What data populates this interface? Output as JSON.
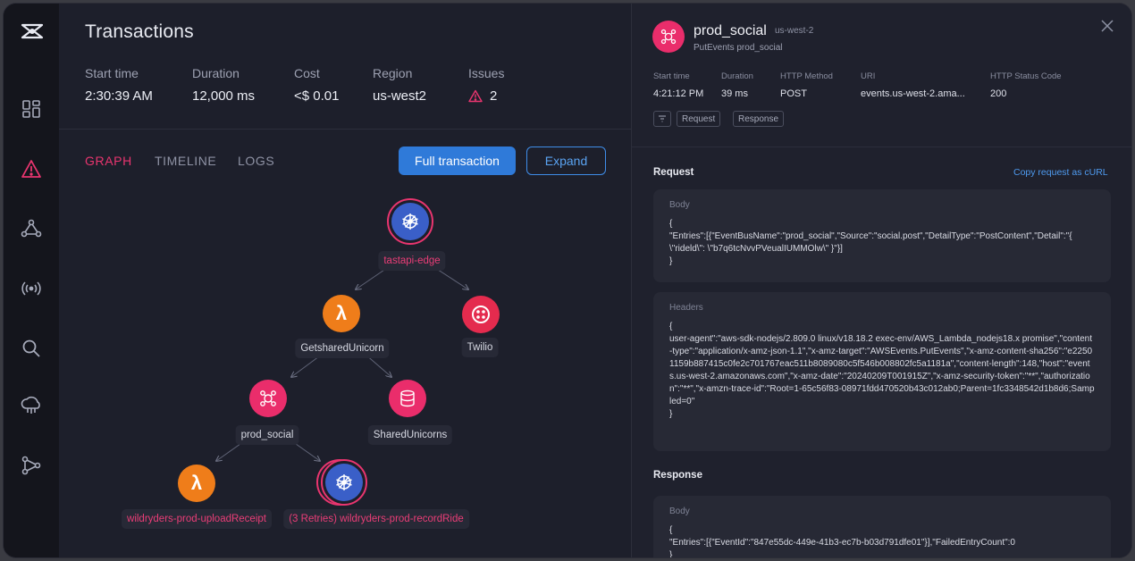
{
  "sidebar": {
    "items": [
      {
        "icon": "logo-icon"
      },
      {
        "icon": "dashboard-icon"
      },
      {
        "icon": "alert-icon",
        "active": true
      },
      {
        "icon": "graph-nodes-icon"
      },
      {
        "icon": "broadcast-icon"
      },
      {
        "icon": "search-icon"
      },
      {
        "icon": "cloud-icon"
      },
      {
        "icon": "share-icon"
      }
    ]
  },
  "left": {
    "title": "Transactions",
    "stats": [
      {
        "label": "Start time",
        "value": "2:30:39 AM"
      },
      {
        "label": "Duration",
        "value": "12,000 ms"
      },
      {
        "label": "Cost",
        "value": "<$ 0.01"
      },
      {
        "label": "Region",
        "value": "us-west2"
      },
      {
        "label": "Issues",
        "value": "2"
      }
    ],
    "tabs": [
      "GRAPH",
      "TIMELINE",
      "LOGS"
    ],
    "active_tab": "GRAPH",
    "full_transaction_label": "Full transaction",
    "expand_label": "Expand"
  },
  "graph": {
    "nodes": [
      {
        "label": "tastapi-edge",
        "kind": "kubernetes",
        "highlight": true
      },
      {
        "label": "GetsharedUnicorn",
        "kind": "lambda",
        "highlight": false
      },
      {
        "label": "Twilio",
        "kind": "twilio",
        "highlight": false
      },
      {
        "label": "prod_social",
        "kind": "eventbridge",
        "highlight": false
      },
      {
        "label": "SharedUnicorns",
        "kind": "dynamodb",
        "highlight": false
      },
      {
        "label": "wildryders-prod-uploadReceipt",
        "kind": "lambda",
        "highlight": true
      },
      {
        "label": "(3 Retries) wildryders-prod-recordRide",
        "kind": "kubernetes",
        "highlight": true
      }
    ]
  },
  "detail": {
    "name": "prod_social",
    "region": "us-west-2",
    "subtitle": "PutEvents prod_social",
    "meta": [
      {
        "label": "Start time",
        "value": "4:21:12 PM"
      },
      {
        "label": "Duration",
        "value": "39 ms"
      },
      {
        "label": "HTTP Method",
        "value": "POST"
      },
      {
        "label": "URI",
        "value": "events.us-west-2.ama..."
      },
      {
        "label": "HTTP Status Code",
        "value": "200"
      }
    ],
    "chips": [
      "Request",
      "Response"
    ],
    "request_title": "Request",
    "copy_label": "Copy request as cURL",
    "body_label": "Body",
    "request_body": "{\n\"Entries\":[{\"EventBusName\":\"prod_social\",\"Source\":\"social.post\",\"DetailType\":\"PostContent\",\"Detail\":\"{\n\\\"rideld\\\": \\\"b7q6tcNvvPVeualIUMMOlw\\\" }\"}]\n}",
    "headers_label": "Headers",
    "headers_body": "{\nuser-agent\":\"aws-sdk-nodejs/2.809.0 linux/v18.18.2 exec-env/AWS_Lambda_nodejs18.x promise\",\"content-type\":\"application/x-amz-json-1.1\",\"x-amz-target\":\"AWSEvents.PutEvents\",\"x-amz-content-sha256\":\"e22501159b887415c0fe2c701767eac511b8089080c5f546b008802fc5a1181a\",\"content-length\":148,\"host\":\"events.us-west-2.amazonaws.com\",\"x-amz-date\":\"20240209T001915Z\",\"x-amz-security-token\":\"**\",\"authorization\":\"**\",\"x-amzn-trace-id\":\"Root=1-65c56f83-08971fdd470520b43c012ab0;Parent=1fc3348542d1b8d6;Sampled=0\"\n}",
    "response_title": "Response",
    "response_body": "{\n\"Entries\":[{\"EventId\":\"847e55dc-449e-41b3-ec7b-b03d791dfe01\"}],\"FailedEntryCount\":0\n}"
  },
  "colors": {
    "accent": "#e9356f",
    "primary": "#2f7ad9",
    "lambda": "#ef7d1a",
    "kube": "#3a5fc8"
  }
}
